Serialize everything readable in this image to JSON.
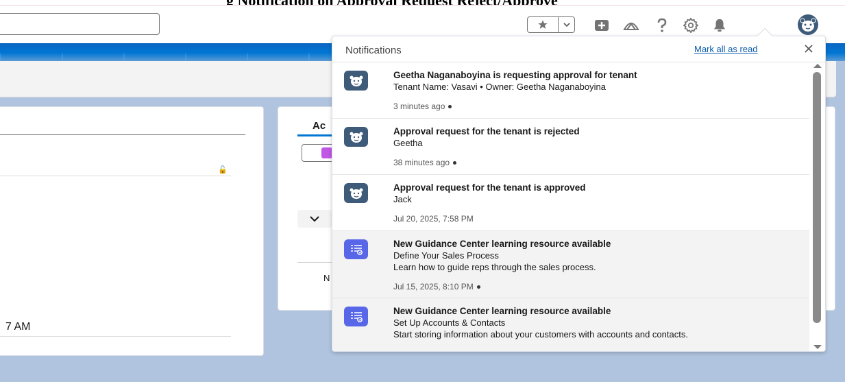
{
  "banner": {
    "text": "g  Notification  on  Approval Request  Reject/Approve"
  },
  "header": {
    "search_placeholder": "",
    "icons": [
      "star-icon",
      "chevron-down-icon",
      "add-icon",
      "trailhead-icon",
      "help-icon",
      "setup-gear-icon",
      "bell-icon",
      "avatar-icon"
    ]
  },
  "card_left": {
    "time_text": "7 AM"
  },
  "card_right": {
    "tab_label": "Ac",
    "n_label": "N"
  },
  "notifications": {
    "title": "Notifications",
    "mark_all_read": "Mark all as read",
    "items": [
      {
        "icon": "einstein-bear-icon",
        "icon_color": "#3e5b7a",
        "title": "Geetha Naganaboyina is requesting approval for tenant",
        "line1": "Tenant Name: Vasavi • Owner: Geetha Naganaboyina",
        "line2": "",
        "time": "3 minutes ago",
        "unread": true
      },
      {
        "icon": "einstein-bear-icon",
        "icon_color": "#3e5b7a",
        "title": "Approval request for the tenant is rejected",
        "line1": "Geetha",
        "line2": "",
        "time": "38 minutes ago",
        "unread": true
      },
      {
        "icon": "einstein-bear-icon",
        "icon_color": "#3e5b7a",
        "title": "Approval request for the tenant is approved",
        "line1": "Jack",
        "line2": "",
        "time": "Jul 20, 2025, 7:58 PM",
        "unread": false
      },
      {
        "icon": "guidance-center-icon",
        "icon_color": "#5867e8",
        "title": "New Guidance Center learning resource available",
        "line1": "Define Your Sales Process",
        "line2": "Learn how to guide reps through the sales process.",
        "time": "Jul 15, 2025, 8:10 PM",
        "unread": true
      },
      {
        "icon": "guidance-center-icon",
        "icon_color": "#5867e8",
        "title": "New Guidance Center learning resource available",
        "line1": "Set Up Accounts & Contacts",
        "line2": "Start storing information about your customers with accounts and contacts.",
        "time": "",
        "unread": true
      }
    ]
  }
}
